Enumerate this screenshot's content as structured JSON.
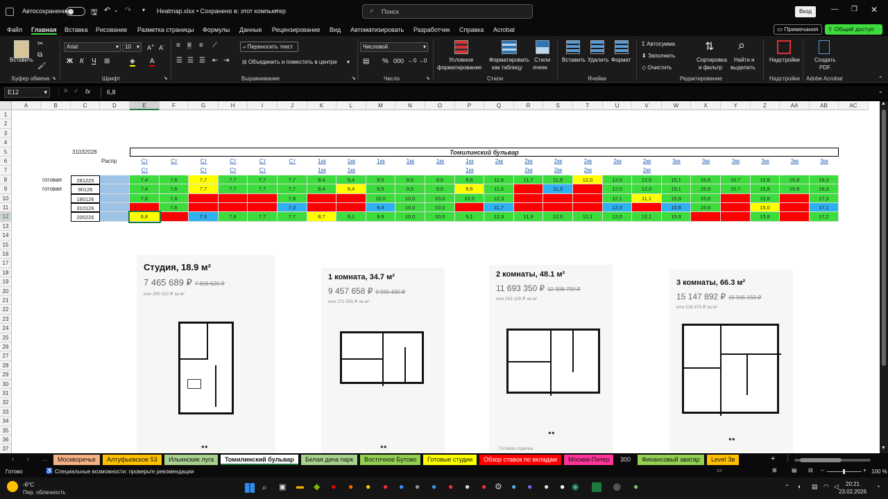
{
  "titlebar": {
    "autosave_label": "Автосохранение",
    "doc_title": "Heatmap.xlsx • Сохранено в: этот компьютер",
    "search_placeholder": "Поиск",
    "signin_label": "Вход"
  },
  "menu": [
    "Файл",
    "Главная",
    "Вставка",
    "Рисование",
    "Разметка страницы",
    "Формулы",
    "Данные",
    "Рецензирование",
    "Вид",
    "Автоматизировать",
    "Разработчик",
    "Справка",
    "Acrobat"
  ],
  "menu_right": {
    "comments": "Примечания",
    "share": "Общий доступ"
  },
  "ribbon": {
    "clipboard": {
      "paste": "Вставить",
      "group": "Буфер обмена"
    },
    "font": {
      "name": "Arial",
      "size": "10",
      "group": "Шрифт"
    },
    "alignment": {
      "wrap": "Переносить текст",
      "merge": "Объединить и поместить в центре",
      "group": "Выравнивание"
    },
    "number": {
      "format": "Числовой",
      "group": "Число"
    },
    "styles": {
      "cond_line1": "Условное",
      "cond_line2": "форматирование",
      "table_line1": "Форматировать",
      "table_line2": "как таблицу",
      "cell_line1": "Стили",
      "cell_line2": "ячеек",
      "group": "Стили"
    },
    "cells": {
      "insert": "Вставить",
      "delete": "Удалить",
      "format": "Формат",
      "group": "Ячейки"
    },
    "editing": {
      "autosum": "Автосумма",
      "fill": "Заполнить",
      "clear": "Очистить",
      "sort_line1": "Сортировка",
      "sort_line2": "и фильтр",
      "find_line1": "Найти и",
      "find_line2": "выделить",
      "group": "Редактирование"
    },
    "addins": {
      "label": "Надстройки",
      "group": "Надстройки"
    },
    "acrobat": {
      "line1": "Создать",
      "line2": "PDF",
      "group": "Adobe Acrobat"
    }
  },
  "formula_bar": {
    "name_box": "E12",
    "fx": "fx",
    "value": "6,8"
  },
  "columns": [
    "A",
    "B",
    "C",
    "D",
    "E",
    "F",
    "G",
    "H",
    "I",
    "J",
    "K",
    "L",
    "M",
    "N",
    "O",
    "P",
    "Q",
    "R",
    "S",
    "T",
    "U",
    "V",
    "W",
    "X",
    "Y",
    "Z",
    "AA",
    "AB",
    "AC"
  ],
  "rows": [
    "1",
    "2",
    "3",
    "4",
    "5",
    "6",
    "7",
    "8",
    "9",
    "10",
    "11",
    "12",
    "13",
    "14",
    "15",
    "16",
    "17",
    "18",
    "19",
    "20",
    "21",
    "22",
    "23",
    "24",
    "25",
    "26",
    "27",
    "28",
    "29",
    "30",
    "31",
    "32",
    "33",
    "34",
    "35",
    "36",
    "37"
  ],
  "sheet": {
    "c5": "31032028",
    "title": "Томилинский бульвар",
    "d6": "Распр",
    "header_row6": [
      "Ст",
      "Ст",
      "Ст",
      "Ст",
      "Ст",
      "Ст",
      "1кк",
      "1кк",
      "1кк",
      "1кк",
      "1кк",
      "1кк",
      "2кк",
      "2кк",
      "2кк",
      "2кк",
      "2кк",
      "2кк",
      "3кк",
      "3кк",
      "3кк",
      "3кк",
      "3кк",
      "3кк"
    ],
    "header_row7": [
      "Ст",
      "",
      "Ст",
      "Ст",
      "Ст",
      "",
      "1кк",
      "1кк",
      "",
      "",
      "",
      "1кк",
      "",
      "2кк",
      "2кк",
      "2кк",
      "",
      "2кк",
      "",
      "",
      "",
      "",
      "",
      ""
    ],
    "status_labels": [
      "готовая",
      "готовая"
    ],
    "row_dates": [
      "281225",
      "90126",
      "180126",
      "310126",
      "200226"
    ],
    "heatmap": [
      [
        [
          "7,4",
          "g"
        ],
        [
          "7,6",
          "g"
        ],
        [
          "7,7",
          "y"
        ],
        [
          "7,7",
          "g"
        ],
        [
          "7,7",
          "g"
        ],
        [
          "7,7",
          "g"
        ],
        [
          "9,4",
          "g"
        ],
        [
          "9,4",
          "g"
        ],
        [
          "9,5",
          "g"
        ],
        [
          "9,5",
          "g"
        ],
        [
          "9,5",
          "g"
        ],
        [
          "9,6",
          "g"
        ],
        [
          "11,6",
          "g"
        ],
        [
          "11,7",
          "g"
        ],
        [
          "11,9",
          "g"
        ],
        [
          "12,0",
          "y"
        ],
        [
          "12,0",
          "g"
        ],
        [
          "12,0",
          "g"
        ],
        [
          "15,1",
          "g"
        ],
        [
          "15,6",
          "g"
        ],
        [
          "15,7",
          "g"
        ],
        [
          "15,8",
          "g"
        ],
        [
          "15,8",
          "g"
        ],
        [
          "16,3",
          "g"
        ]
      ],
      [
        [
          "7,4",
          "g"
        ],
        [
          "7,6",
          "g"
        ],
        [
          "7,7",
          "y"
        ],
        [
          "7,7",
          "g"
        ],
        [
          "7,7",
          "g"
        ],
        [
          "7,7",
          "g"
        ],
        [
          "9,4",
          "g"
        ],
        [
          "9,4",
          "y"
        ],
        [
          "9,5",
          "g"
        ],
        [
          "9,5",
          "g"
        ],
        [
          "9,5",
          "g"
        ],
        [
          "9,6",
          "y"
        ],
        [
          "11,6",
          "g"
        ],
        [
          "",
          "r"
        ],
        [
          "11,3",
          "b"
        ],
        [
          "",
          "r"
        ],
        [
          "12,0",
          "g"
        ],
        [
          "12,0",
          "g"
        ],
        [
          "15,1",
          "g"
        ],
        [
          "15,6",
          "g"
        ],
        [
          "15,7",
          "g"
        ],
        [
          "15,8",
          "g"
        ],
        [
          "15,8",
          "g"
        ],
        [
          "16,3",
          "g"
        ]
      ],
      [
        [
          "7,8",
          "g"
        ],
        [
          "7,6",
          "g"
        ],
        [
          "",
          "r"
        ],
        [
          "",
          "r"
        ],
        [
          "",
          "r"
        ],
        [
          "7,8",
          "g"
        ],
        [
          "",
          "r"
        ],
        [
          "",
          "r"
        ],
        [
          "10,0",
          "g"
        ],
        [
          "10,0",
          "g"
        ],
        [
          "10,0",
          "g"
        ],
        [
          "10,0",
          "g"
        ],
        [
          "12,3",
          "g"
        ],
        [
          "",
          "r"
        ],
        [
          "",
          "r"
        ],
        [
          "",
          "r"
        ],
        [
          "12,1",
          "g"
        ],
        [
          "11,1",
          "y"
        ],
        [
          "15,9",
          "g"
        ],
        [
          "15,6",
          "g"
        ],
        [
          "",
          "r"
        ],
        [
          "15,8",
          "g"
        ],
        [
          "",
          "r"
        ],
        [
          "17,2",
          "g"
        ]
      ],
      [
        [
          "",
          "r"
        ],
        [
          "7,6",
          "g"
        ],
        [
          "",
          "r"
        ],
        [
          "",
          "r"
        ],
        [
          "",
          "r"
        ],
        [
          "7,3",
          "b"
        ],
        [
          "",
          "r"
        ],
        [
          "",
          "r"
        ],
        [
          "9,4",
          "b"
        ],
        [
          "10,0",
          "g"
        ],
        [
          "10,0",
          "g"
        ],
        [
          "",
          "r"
        ],
        [
          "11,7",
          "b"
        ],
        [
          "",
          "r"
        ],
        [
          "",
          "r"
        ],
        [
          "",
          "r"
        ],
        [
          "12,0",
          "b"
        ],
        [
          "",
          "r"
        ],
        [
          "15,8",
          "b"
        ],
        [
          "15,6",
          "g"
        ],
        [
          "",
          "r"
        ],
        [
          "15,0",
          "y"
        ],
        [
          "",
          "r"
        ],
        [
          "17,1",
          "b"
        ]
      ],
      [
        [
          "6,8",
          "y"
        ],
        [
          "",
          "r"
        ],
        [
          "7,3",
          "b"
        ],
        [
          "7,6",
          "g"
        ],
        [
          "7,7",
          "g"
        ],
        [
          "7,7",
          "g"
        ],
        [
          "8,7",
          "y"
        ],
        [
          "9,1",
          "g"
        ],
        [
          "9,9",
          "g"
        ],
        [
          "10,0",
          "g"
        ],
        [
          "10,0",
          "g"
        ],
        [
          "9,1",
          "g"
        ],
        [
          "12,3",
          "g"
        ],
        [
          "11,9",
          "g"
        ],
        [
          "12,0",
          "g"
        ],
        [
          "12,1",
          "g"
        ],
        [
          "12,0",
          "g"
        ],
        [
          "12,1",
          "g"
        ],
        [
          "15,9",
          "g"
        ],
        [
          "",
          "r"
        ],
        [
          "",
          "r"
        ],
        [
          "15,8",
          "g"
        ],
        [
          "",
          "r"
        ],
        [
          "17,2",
          "g"
        ]
      ]
    ]
  },
  "cards": [
    {
      "title": "Студия, 18.9 м²",
      "price": "7 465 689 ₽",
      "old": "7 858 620 ₽",
      "per_m": "или 395 010 ₽ за м²"
    },
    {
      "title": "1 комната, 34.7 м²",
      "price": "9 457 658 ₽",
      "old": "9 955 430 ₽",
      "per_m": "или 272 555 ₽ за м²"
    },
    {
      "title": "2 комнаты, 48.1 м²",
      "price": "11 693 350 ₽",
      "old": "12 308 790 ₽",
      "per_m": "или 243 105 ₽ за м²",
      "footer": "Готовая отделка"
    },
    {
      "title": "3 комнаты, 66.3 м²",
      "price": "15 147 892 ₽",
      "old": "15 945 150 ₽",
      "per_m": "или 228 475 ₽ за м²"
    }
  ],
  "tabs": [
    {
      "label": "Москворечье",
      "color": "#f4b183"
    },
    {
      "label": "Алтуфьевское 53",
      "color": "#ffc000"
    },
    {
      "label": "Ильинские луга",
      "color": "#a9d18e"
    },
    {
      "label": "Томилинский бульвар",
      "color": "#ffffff"
    },
    {
      "label": "Белая дача парк",
      "color": "#a9d18e"
    },
    {
      "label": "Восточное Бутово",
      "color": "#92d050"
    },
    {
      "label": "Готовые студии",
      "color": "#ffff00"
    },
    {
      "label": "Обзор ставок по вкладам",
      "color": "#ff0000"
    },
    {
      "label": "Москва-Питер",
      "color": "#ff3399"
    },
    {
      "label": "300",
      "color": "#0a0a0a"
    },
    {
      "label": "Финансовый аватар",
      "color": "#92d050"
    },
    {
      "label": "Level Зв",
      "color": "#ffc000"
    }
  ],
  "status": {
    "ready": "Готово",
    "accessibility": "Специальные возможности: проверьте рекомендации",
    "zoom": "100 %"
  },
  "taskbar": {
    "temp": "-6°C",
    "weather": "Пер. облачность",
    "time": "20:21",
    "date": "23.02.2026"
  },
  "colors": {
    "g": "#3ddc3d",
    "y": "#ffff00",
    "r": "#ff0000",
    "b": "#2fb0f0",
    "blank": "#9dc3e6"
  }
}
